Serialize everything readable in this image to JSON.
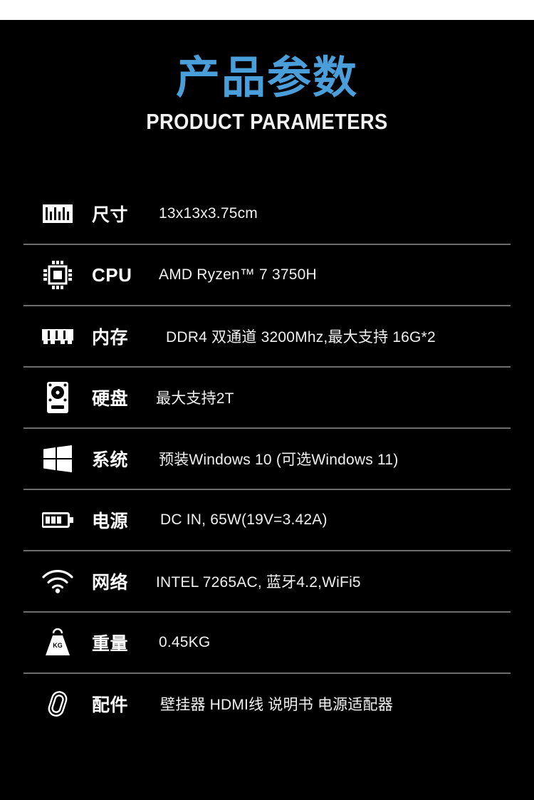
{
  "header": {
    "title_cn": "产品参数",
    "title_en": "PRODUCT PARAMETERS",
    "title_cn_color": "#4a9ed9",
    "title_en_color": "#f2f2f2"
  },
  "theme": {
    "background": "#000000",
    "divider": "#6d6d6d",
    "text": "#f0f0f0",
    "accent": "#4a9ed9"
  },
  "specs": {
    "rows": [
      {
        "key": "size",
        "icon": "ruler-icon",
        "label": "尺寸",
        "value": "13x13x3.75cm"
      },
      {
        "key": "cpu",
        "icon": "chip-icon",
        "label": "CPU",
        "value": "AMD Ryzen™ 7 3750H"
      },
      {
        "key": "memory",
        "icon": "ram-icon",
        "label": "内存",
        "value": "DDR4 双通道 3200Mhz,最大支持 16G*2"
      },
      {
        "key": "storage",
        "icon": "harddisk-icon",
        "label": "硬盘",
        "value": "最大支持2T"
      },
      {
        "key": "os",
        "icon": "windows-icon",
        "label": "系统",
        "value": "预装Windows 10 (可选Windows 11)"
      },
      {
        "key": "power",
        "icon": "battery-icon",
        "label": "电源",
        "value": "DC IN, 65W(19V=3.42A)"
      },
      {
        "key": "network",
        "icon": "wifi-icon",
        "label": "网络",
        "value": "INTEL 7265AC, 蓝牙4.2,WiFi5"
      },
      {
        "key": "weight",
        "icon": "weight-icon",
        "label": "重量",
        "value": "0.45KG",
        "icon_text": "KG"
      },
      {
        "key": "accessories",
        "icon": "paperclip-icon",
        "label": "配件",
        "value": "壁挂器 HDMI线 说明书 电源适配器"
      }
    ]
  }
}
